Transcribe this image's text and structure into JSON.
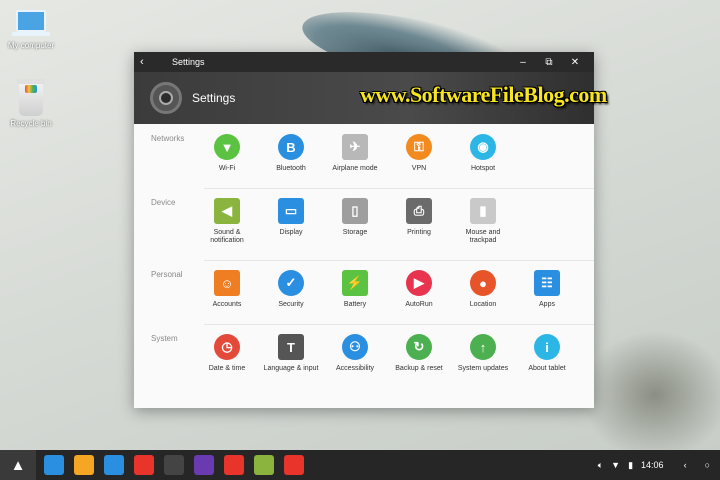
{
  "desktop": {
    "icons": [
      {
        "label": "My computer",
        "icon": "computer-icon"
      },
      {
        "label": "Recycle bin",
        "icon": "recycle-bin-icon"
      }
    ]
  },
  "window": {
    "titlebar_title": "Settings",
    "controls": [
      "back-icon",
      "minimize-icon",
      "maximize-icon",
      "close-icon"
    ],
    "header_title": "Settings",
    "watermark": "www.SoftwareFileBlog.com"
  },
  "sections": [
    {
      "label": "Networks",
      "items": [
        {
          "label": "Wi-Fi",
          "icon": "wifi-icon",
          "color": "#5cc241"
        },
        {
          "label": "Bluetooth",
          "icon": "bluetooth-icon",
          "color": "#2b8fe0"
        },
        {
          "label": "Airplane mode",
          "icon": "airplane-icon",
          "color": "#b8b8b8"
        },
        {
          "label": "VPN",
          "icon": "vpn-icon",
          "color": "#f28a1e"
        },
        {
          "label": "Hotspot",
          "icon": "hotspot-icon",
          "color": "#2cb6e6"
        }
      ]
    },
    {
      "label": "Device",
      "items": [
        {
          "label": "Sound & notification",
          "icon": "sound-icon",
          "color": "#8ab43e"
        },
        {
          "label": "Display",
          "icon": "display-icon",
          "color": "#2a8fe0"
        },
        {
          "label": "Storage",
          "icon": "storage-icon",
          "color": "#9e9e9e"
        },
        {
          "label": "Printing",
          "icon": "printer-icon",
          "color": "#6b6b6b"
        },
        {
          "label": "Mouse and trackpad",
          "icon": "mouse-icon",
          "color": "#c9c9c9"
        }
      ]
    },
    {
      "label": "Personal",
      "items": [
        {
          "label": "Accounts",
          "icon": "accounts-icon",
          "color": "#ef7d22"
        },
        {
          "label": "Security",
          "icon": "security-icon",
          "color": "#2a8fe0"
        },
        {
          "label": "Battery",
          "icon": "battery-icon",
          "color": "#5cc241"
        },
        {
          "label": "AutoRun",
          "icon": "autorun-icon",
          "color": "#e8344f"
        },
        {
          "label": "Location",
          "icon": "location-icon",
          "color": "#e8542a"
        },
        {
          "label": "Apps",
          "icon": "apps-icon",
          "color": "#2a8fe0"
        }
      ]
    },
    {
      "label": "System",
      "items": [
        {
          "label": "Date & time",
          "icon": "clock-icon",
          "color": "#e44a3a"
        },
        {
          "label": "Language & input",
          "icon": "language-icon",
          "color": "#555555"
        },
        {
          "label": "Accessibility",
          "icon": "accessibility-icon",
          "color": "#2a8fe0"
        },
        {
          "label": "Backup & reset",
          "icon": "backup-icon",
          "color": "#4caf50"
        },
        {
          "label": "System updates",
          "icon": "update-icon",
          "color": "#4caf50"
        },
        {
          "label": "About tablet",
          "icon": "info-icon",
          "color": "#2cb6e6"
        }
      ]
    }
  ],
  "taskbar": {
    "apps": [
      {
        "icon": "browser-icon",
        "color": "#2a8fe0"
      },
      {
        "icon": "files-icon",
        "color": "#f5a623"
      },
      {
        "icon": "mail-icon",
        "color": "#2a8fe0"
      },
      {
        "icon": "office-icon",
        "color": "#e8342a"
      },
      {
        "icon": "settings-icon",
        "color": "#444444"
      },
      {
        "icon": "video-icon",
        "color": "#6a3bb0"
      },
      {
        "icon": "pdf-icon",
        "color": "#e8342a"
      },
      {
        "icon": "search-app-icon",
        "color": "#8ab43e"
      },
      {
        "icon": "screenshot-icon",
        "color": "#e8342a"
      }
    ],
    "time": "14:06"
  }
}
